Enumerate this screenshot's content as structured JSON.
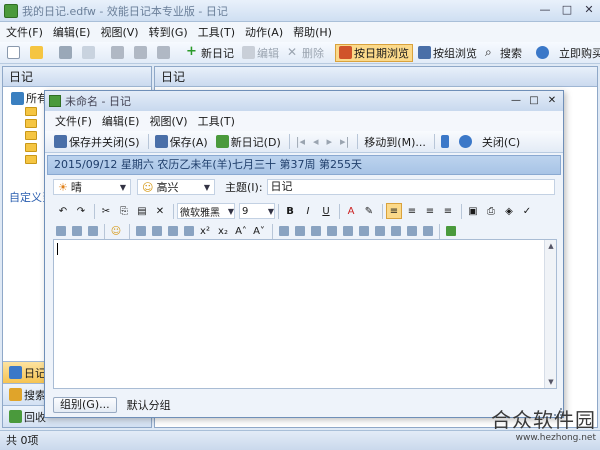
{
  "window": {
    "title": "我的日记.edfw - 效能日记本专业版 - 日记",
    "controls": [
      "—",
      "□",
      "✕"
    ]
  },
  "menu": [
    "文件(F)",
    "编辑(E)",
    "视图(V)",
    "转到(G)",
    "工具(T)",
    "动作(A)",
    "帮助(H)"
  ],
  "toolbar": {
    "new_diary": "新日记",
    "edit": "编辑",
    "delete": "删除",
    "by_date": "按日期浏览",
    "by_group": "按组浏览",
    "search": "搜索",
    "buy_now": "立即购买"
  },
  "sidebar": {
    "header": "日记",
    "root_label": "所有",
    "folder_count_visible": 5,
    "custom_link": "自定义当",
    "nav": [
      {
        "label": "日记",
        "selected": true
      },
      {
        "label": "搜索",
        "selected": false
      },
      {
        "label": "回收",
        "selected": false
      }
    ]
  },
  "right_pane": {
    "header": "日记"
  },
  "statusbar": {
    "text": "共 0项"
  },
  "dialog": {
    "title": "未命名 - 日记",
    "controls": [
      "—",
      "□",
      "✕"
    ],
    "menu": [
      "文件(F)",
      "编辑(E)",
      "视图(V)",
      "工具(T)"
    ],
    "toolbar": {
      "save_close": "保存并关闭(S)",
      "save": "保存(A)",
      "new_diary": "新日记(D)",
      "move_to": "移动到(M)...",
      "close": "关闭(C)"
    },
    "date_line": "2015/09/12 星期六 农历乙未年(羊)七月三十  第37周 第255天",
    "weather": "晴",
    "mood": "高兴",
    "subject_label": "主题(I):",
    "subject_value": "日记",
    "font_name": "微软雅黑",
    "font_size": "9",
    "group_button": "组别(G)...",
    "group_value": "默认分组"
  },
  "watermark": {
    "main": "合众软件园",
    "sub": "www.hezhong.net"
  },
  "colors": {
    "accent": "#fbd98a",
    "date_bar": "#bcd3ee",
    "panel_border": "#8fa8c8"
  }
}
